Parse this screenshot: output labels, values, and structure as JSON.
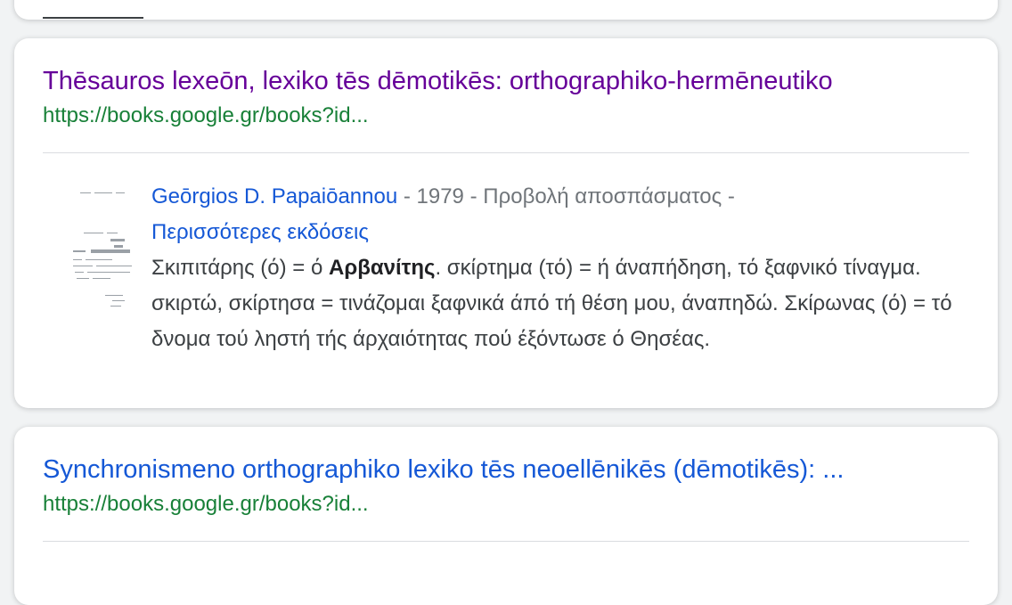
{
  "result1": {
    "title": "Thēsauros lexeōn, lexiko tēs dēmotikēs: orthographiko-hermēneutiko",
    "url": "https://books.google.gr/books?id...",
    "author": "Geōrgios D. Papaiōannou",
    "meta_rest": " - 1979 - Προβολή αποσπάσματος -",
    "more_editions": "Περισσότερες εκδόσεις",
    "snippet_before": "Σκιπιτάρης (ό) = ό ",
    "snippet_bold": "Αρβανίτης",
    "snippet_after": ". σκίρτημα (τό) = ή άναπήδηση, τό ξαφνικό τίναγμα. σκιρτώ, σκίρτησα = τινάζομαι ξαφνικά άπό τή θέση μου, άναπηδώ. Σκίρωνας (ό) = τό δνομα τού ληστή τής άρχαιότητας πού έξόντωσε ό Θησέας."
  },
  "result2": {
    "title": "Synchronismeno orthographiko lexiko tēs neoellēnikēs (dēmotikēs): ...",
    "url": "https://books.google.gr/books?id..."
  }
}
